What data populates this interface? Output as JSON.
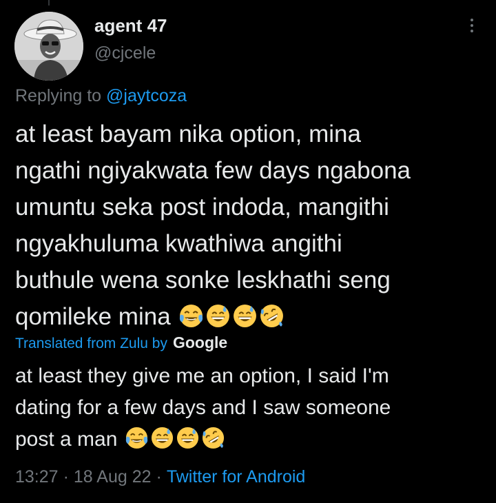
{
  "author": {
    "name": "agent 47",
    "handle": "@cjcele"
  },
  "reply": {
    "prefix": "Replying to ",
    "to_handle": "@jaytcoza"
  },
  "tweet": {
    "lines": [
      "at least bayam nika option, mina",
      "ngathi ngiyakwata few days ngabona",
      "umuntu seka post indoda, mangithi",
      "ngyakhuluma kwathiwa angithi",
      "buthule wena sonke leskhathi seng",
      "qomileke mina"
    ],
    "emojis": [
      "face-with-tears-of-joy",
      "grinning-sweat",
      "grinning-sweat",
      "rolling-on-floor-laughing"
    ]
  },
  "translation": {
    "label": "Translated from Zulu by",
    "provider": "Google",
    "lines": [
      "at least they give me an option, I said I'm",
      "dating for a few days and I saw someone",
      "post a man"
    ]
  },
  "meta": {
    "time": "13:27",
    "date": "18 Aug 22",
    "separator": "·",
    "source": "Twitter for Android"
  },
  "colors": {
    "background": "#000000",
    "text": "#e7e9ea",
    "muted": "#71767b",
    "accent": "#1d9bf0"
  },
  "icons": {
    "more": "more-vertical-icon"
  }
}
